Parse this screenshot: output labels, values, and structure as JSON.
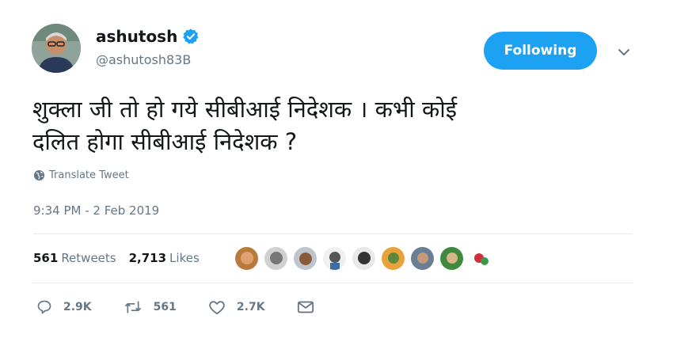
{
  "author": {
    "display_name": "ashutosh",
    "handle": "@ashutosh83B",
    "verified": true
  },
  "follow_button": {
    "label": "Following"
  },
  "tweet": {
    "text_line1": "शुक्ला जी तो हो गये सीबीआई निदेशक । कभी कोई",
    "text_line2": "दलित होगा सीबीआई निदेशक ?",
    "translate_label": "Translate Tweet",
    "timestamp": "9:34 PM - 2 Feb 2019"
  },
  "stats": {
    "retweets_count": "561",
    "retweets_label": "Retweets",
    "likes_count": "2,713",
    "likes_label": "Likes"
  },
  "actions": {
    "reply_count": "2.9K",
    "retweet_count": "561",
    "like_count": "2.7K"
  },
  "colors": {
    "accent": "#1da1f2",
    "muted": "#657786",
    "divider": "#e6ecf0"
  },
  "icons": [
    "verified-badge-icon",
    "chevron-down-icon",
    "globe-icon",
    "reply-icon",
    "retweet-icon",
    "like-icon",
    "message-icon"
  ]
}
